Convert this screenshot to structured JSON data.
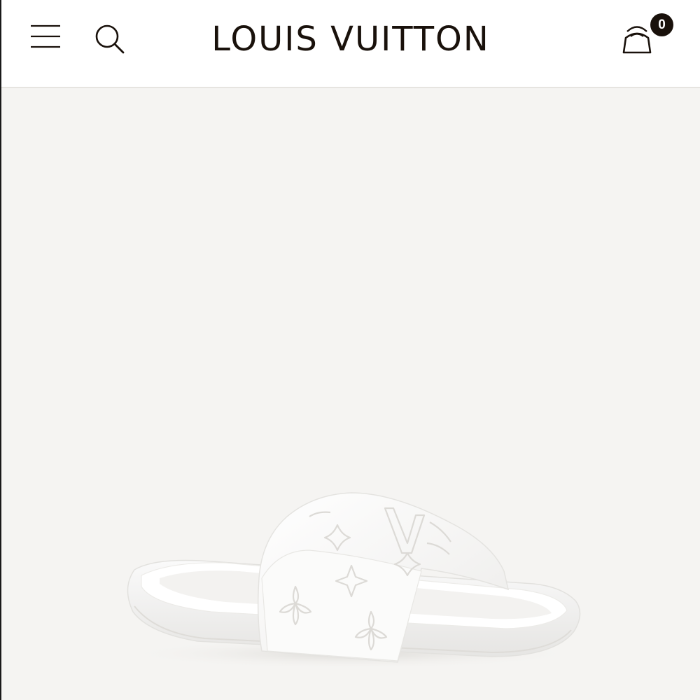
{
  "header": {
    "brand": "LOUIS VUITTON",
    "cart_count": "0",
    "icons": {
      "menu": "hamburger-menu-icon",
      "search": "search-icon",
      "cart": "shopping-bag-icon"
    }
  },
  "product": {
    "image": "white-monogram-embossed-slide-sandal"
  },
  "colors": {
    "brand_text": "#19110b",
    "page_background": "#f5f4f2",
    "header_background": "#ffffff"
  }
}
